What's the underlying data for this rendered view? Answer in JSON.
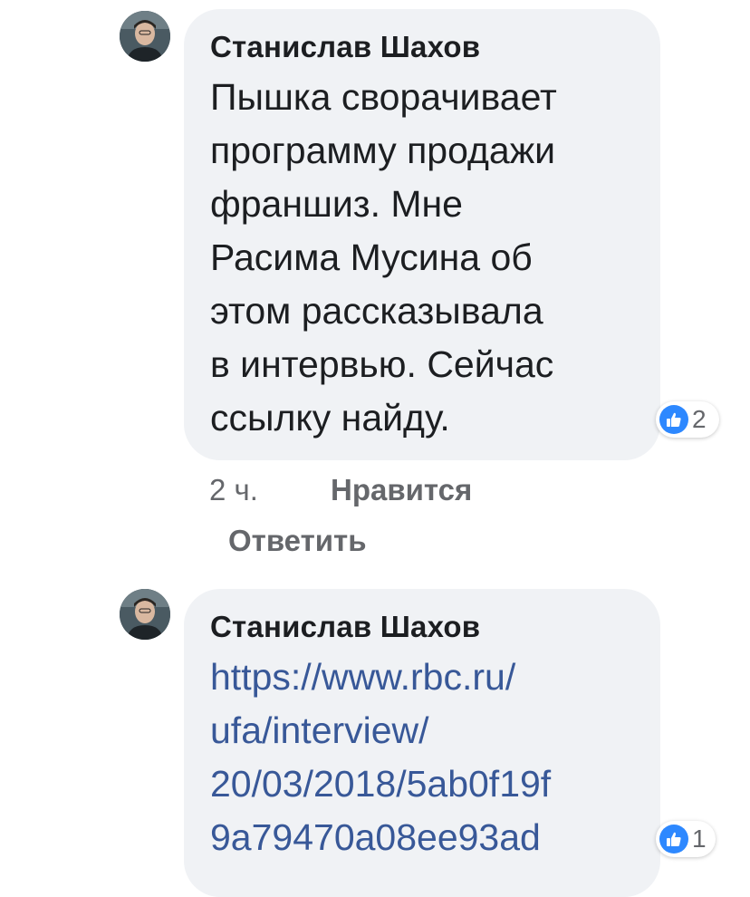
{
  "comments": [
    {
      "author": "Станислав Шахов",
      "lines": [
        "Пышка сворачивает",
        "программу продажи",
        "франшиз. Мне",
        "Расима Мусина об",
        "этом рассказывала",
        "в интервью. Сейчас",
        "ссылку найду."
      ],
      "reaction_count": "2",
      "time": "2 ч.",
      "like_label": "Нравится",
      "reply_label": "Ответить"
    },
    {
      "author": "Станислав Шахов",
      "link_lines": [
        "https://www.rbc.ru/",
        "ufa/interview/",
        "20/03/2018/5ab0f19f",
        "9a79470a08ee93ad"
      ],
      "reaction_count": "1"
    }
  ],
  "colors": {
    "bubble": "#f0f2f5",
    "link": "#385898",
    "like": "#2d88ff",
    "meta_text": "#65676b"
  },
  "icons": {
    "avatar": "user-avatar-photo",
    "reaction": "thumbs-up-icon"
  }
}
